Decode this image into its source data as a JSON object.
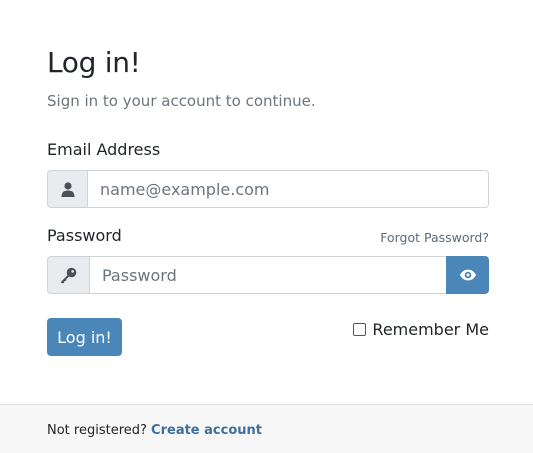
{
  "header": {
    "title": "Log in!",
    "subtitle": "Sign in to your account to continue."
  },
  "email": {
    "label": "Email Address",
    "placeholder": "name@example.com",
    "value": "",
    "icon": "user-icon"
  },
  "password": {
    "label": "Password",
    "placeholder": "Password",
    "value": "",
    "icon": "key-icon",
    "toggle_icon": "eye-icon",
    "forgot_label": "Forgot Password?"
  },
  "actions": {
    "login_label": "Log in!",
    "remember_label": "Remember Me",
    "remember_checked": false
  },
  "footer": {
    "prompt": "Not registered?",
    "link_label": "Create account"
  },
  "colors": {
    "primary": "#4a86b7",
    "link": "#3f6f9a",
    "muted": "#6c757d",
    "addon_bg": "#e9ecef",
    "footer_bg": "#f7f7f7"
  }
}
